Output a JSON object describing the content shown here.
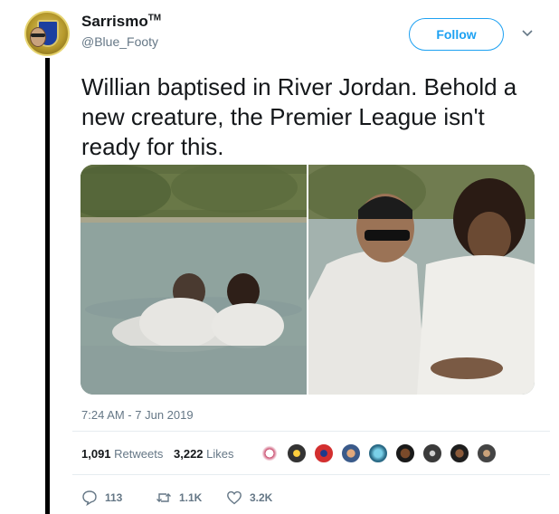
{
  "author": {
    "display_name": "Sarrismo",
    "trademark": "TM",
    "handle": "@Blue_Footy"
  },
  "follow_label": "Follow",
  "tweet_text": "Willian baptised in River Jordan. Behold a new creature, the Premier League isn't ready for this.",
  "media": [
    {
      "label": "baptism-photo-wide"
    },
    {
      "label": "baptism-photo-closeup"
    }
  ],
  "timestamp": "7:24 AM - 7 Jun 2019",
  "stats": {
    "retweets_count": "1,091",
    "retweets_label": "Retweets",
    "likes_count": "3,222",
    "likes_label": "Likes"
  },
  "actions": {
    "replies": "113",
    "retweets": "1.1K",
    "likes": "3.2K"
  },
  "colors": {
    "accent": "#1da1f2",
    "muted": "#657786",
    "text": "#14171a"
  },
  "icons": [
    "chevron-down-icon",
    "reply-icon",
    "retweet-icon",
    "heart-icon"
  ]
}
